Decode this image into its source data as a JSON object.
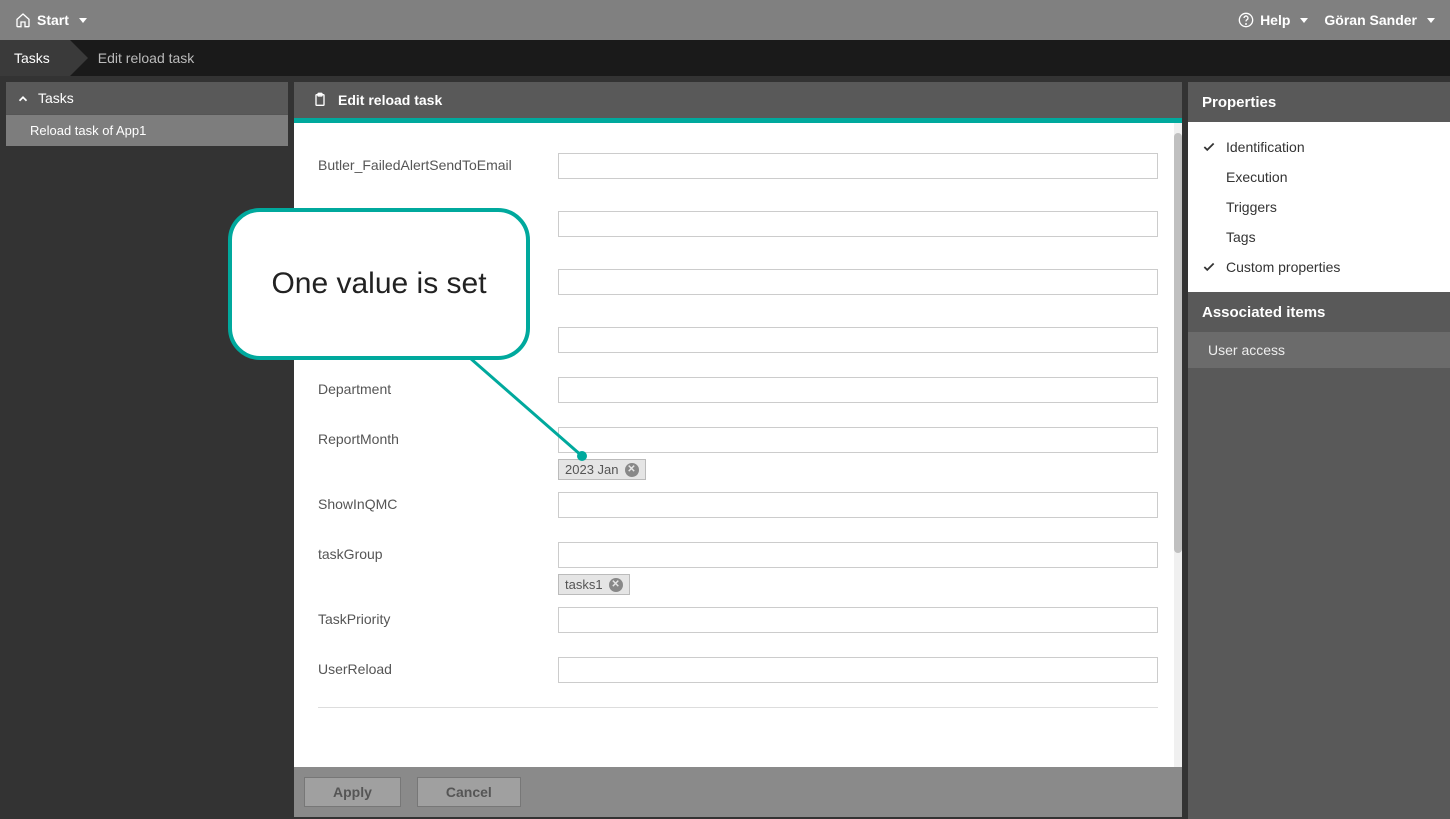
{
  "topbar": {
    "start": "Start",
    "help": "Help",
    "user": "Göran Sander"
  },
  "breadcrumb": {
    "tasks": "Tasks",
    "edit": "Edit reload task"
  },
  "leftSidebar": {
    "header": "Tasks",
    "item1": "Reload task of App1"
  },
  "centerPanel": {
    "title": "Edit reload task"
  },
  "form": {
    "field_butler": "Butler_FailedAlertSendToEmail",
    "field_department": "Department",
    "field_reportmonth": "ReportMonth",
    "tag_reportmonth": "2023 Jan",
    "field_showinqmc": "ShowInQMC",
    "field_taskgroup": "taskGroup",
    "tag_taskgroup": "tasks1",
    "field_taskpriority": "TaskPriority",
    "field_userreload": "UserReload"
  },
  "footer": {
    "apply": "Apply",
    "cancel": "Cancel"
  },
  "rightSidebar": {
    "properties": "Properties",
    "identification": "Identification",
    "execution": "Execution",
    "triggers": "Triggers",
    "tags": "Tags",
    "custom": "Custom properties",
    "associated": "Associated items",
    "useraccess": "User access"
  },
  "callout": {
    "text": "One value is set"
  }
}
